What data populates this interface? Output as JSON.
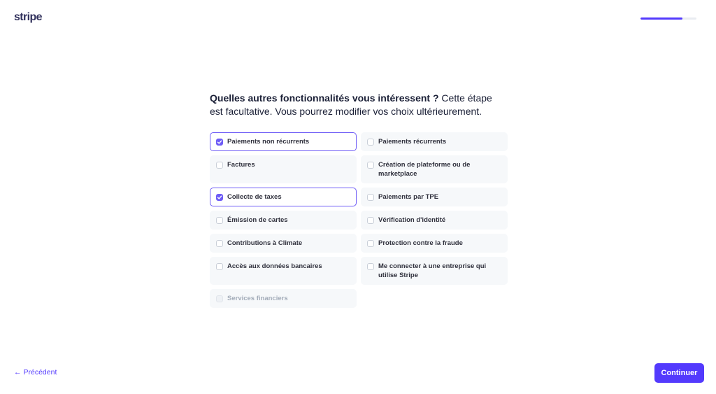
{
  "header": {
    "logo_text": "stripe",
    "progress_fraction": 0.75,
    "accent_color": "#533afd"
  },
  "question": {
    "bold": "Quelles autres fonctionnalités vous intéressent ?",
    "rest": " Cette étape est facultative. Vous pourrez modifier vos choix ultérieurement."
  },
  "options": [
    {
      "label": "Paiements non récurrents",
      "checked": true,
      "disabled": false
    },
    {
      "label": "Paiements récurrents",
      "checked": false,
      "disabled": false
    },
    {
      "label": "Factures",
      "checked": false,
      "disabled": false
    },
    {
      "label": "Création de plateforme ou de marketplace",
      "checked": false,
      "disabled": false
    },
    {
      "label": "Collecte de taxes",
      "checked": true,
      "disabled": false
    },
    {
      "label": "Paiements par TPE",
      "checked": false,
      "disabled": false
    },
    {
      "label": "Émission de cartes",
      "checked": false,
      "disabled": false
    },
    {
      "label": "Vérification d'identité",
      "checked": false,
      "disabled": false
    },
    {
      "label": "Contributions à Climate",
      "checked": false,
      "disabled": false
    },
    {
      "label": "Protection contre la fraude",
      "checked": false,
      "disabled": false
    },
    {
      "label": "Accès aux données bancaires",
      "checked": false,
      "disabled": false
    },
    {
      "label": "Me connecter à une entreprise qui utilise Stripe",
      "checked": false,
      "disabled": false
    },
    {
      "label": "Services financiers",
      "checked": false,
      "disabled": true
    }
  ],
  "footer": {
    "back_arrow": "←",
    "back_label": "Précédent",
    "continue_label": "Continuer"
  }
}
